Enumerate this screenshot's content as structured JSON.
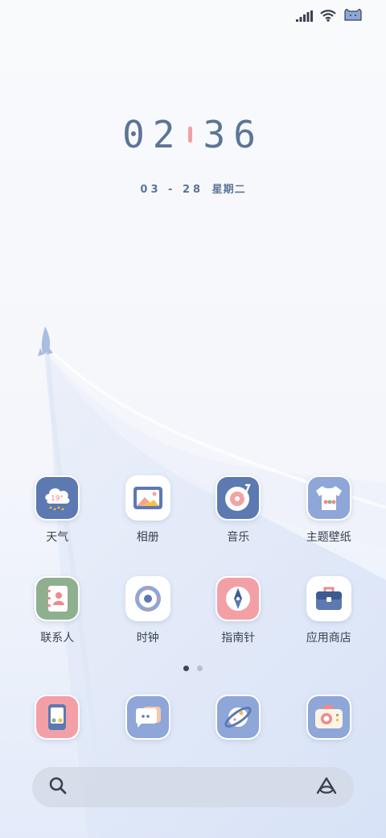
{
  "status_bar": {
    "signal_icon": "signal-bars-icon",
    "wifi_icon": "wifi-icon",
    "battery_icon": "battery-icon"
  },
  "lockclock": {
    "hours": "02",
    "minutes": "36",
    "date": "03 - 28",
    "weekday": "星期二"
  },
  "row1": [
    {
      "label": "天气",
      "icon": "weather-cloud-icon",
      "bg": "#5c79b2",
      "temp": "19°"
    },
    {
      "label": "相册",
      "icon": "gallery-icon",
      "bg": "#ffffff"
    },
    {
      "label": "音乐",
      "icon": "music-record-icon",
      "bg": "#5c79b2"
    },
    {
      "label": "主题壁纸",
      "icon": "theme-shirt-icon",
      "bg": "#8ea6d8"
    }
  ],
  "row2": [
    {
      "label": "联系人",
      "icon": "contacts-book-icon",
      "bg": "#8fb08f"
    },
    {
      "label": "时钟",
      "icon": "clock-icon",
      "bg": "#ffffff"
    },
    {
      "label": "指南针",
      "icon": "compass-icon",
      "bg": "#f2a0a6"
    },
    {
      "label": "应用商店",
      "icon": "app-store-bag-icon",
      "bg": "#ffffff"
    }
  ],
  "dock": [
    {
      "icon": "phone-app-icon",
      "bg": "#f2a0a6"
    },
    {
      "icon": "messages-icon",
      "bg": "#8ea6d8"
    },
    {
      "icon": "browser-planet-icon",
      "bg": "#8ea6d8"
    },
    {
      "icon": "camera-icon",
      "bg": "#8ea6d8"
    }
  ],
  "page_indicator": {
    "pages": 2,
    "current": 1
  },
  "search": {
    "search_icon": "search-icon",
    "assistant_icon": "assistant-icon"
  }
}
